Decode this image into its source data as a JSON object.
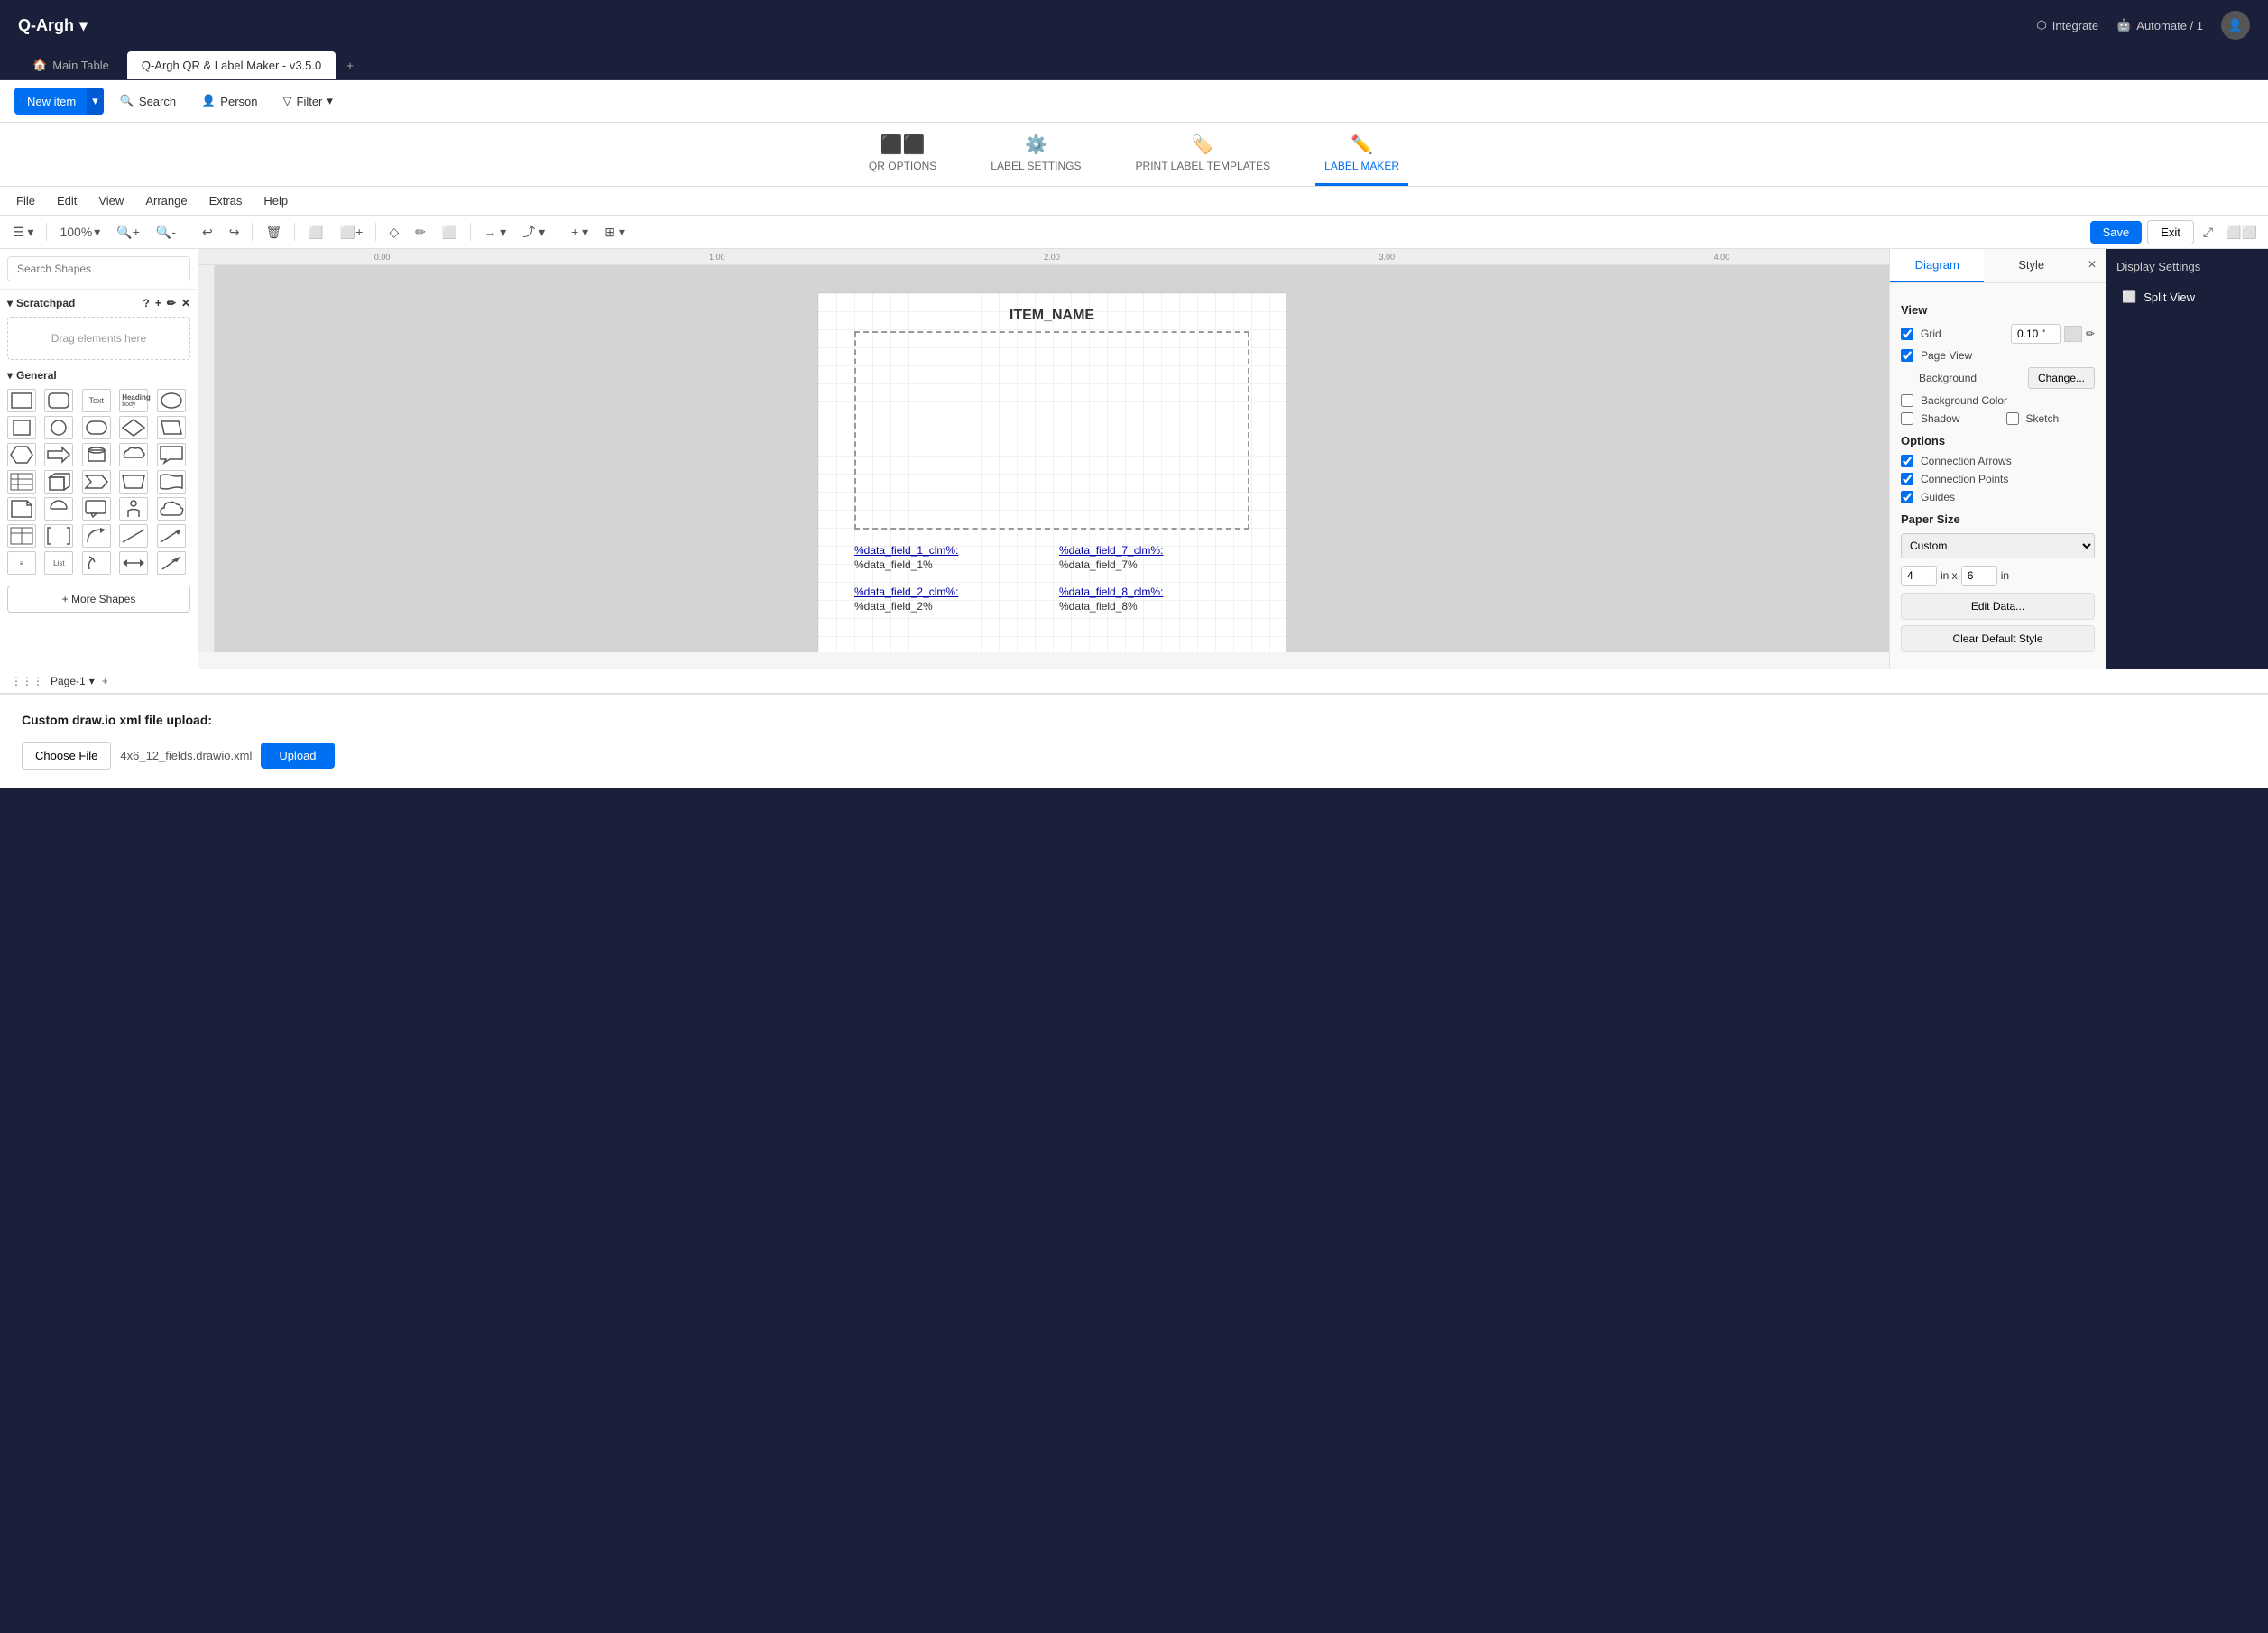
{
  "app": {
    "name": "Q-Argh",
    "dropdown_arrow": "▾"
  },
  "top_nav": {
    "integrate_label": "Integrate",
    "automate_label": "Automate / 1"
  },
  "tabs": [
    {
      "label": "Main Table",
      "icon": "🏠",
      "active": false
    },
    {
      "label": "Q-Argh QR & Label Maker - v3.5.0",
      "icon": "",
      "active": true
    },
    {
      "label": "+",
      "icon": "",
      "active": false
    }
  ],
  "toolbar": {
    "new_item_label": "New item",
    "search_label": "Search",
    "person_label": "Person",
    "filter_label": "Filter"
  },
  "sub_tabs": [
    {
      "label": "QR OPTIONS",
      "icon": "⬛",
      "active": false
    },
    {
      "label": "LABEL SETTINGS",
      "icon": "⚙️",
      "active": false
    },
    {
      "label": "PRINT LABEL TEMPLATES",
      "icon": "🏷️",
      "active": false
    },
    {
      "label": "LABEL MAKER",
      "icon": "✏️",
      "active": true
    }
  ],
  "menu_items": [
    "File",
    "Edit",
    "View",
    "Arrange",
    "Extras",
    "Help"
  ],
  "draw_toolbar": {
    "zoom_level": "100%",
    "save_label": "Save",
    "exit_label": "Exit"
  },
  "left_panel": {
    "search_placeholder": "Search Shapes",
    "scratchpad_label": "Scratchpad",
    "scratchpad_drag_text": "Drag elements here",
    "general_label": "General",
    "more_shapes_label": "+ More Shapes"
  },
  "canvas": {
    "item_name": "ITEM_NAME",
    "ruler_marks": [
      "0.00",
      "1.00",
      "2.00",
      "3.00",
      "4.00"
    ],
    "page_label": "Page-1",
    "fields": [
      {
        "label": "%data_field_1_clm%:",
        "value": "%data_field_1%"
      },
      {
        "label": "%data_field_7_clm%:",
        "value": "%data_field_7%"
      },
      {
        "label": "%data_field_2_clm%:",
        "value": "%data_field_2%"
      },
      {
        "label": "%data_field_8_clm%:",
        "value": "%data_field_8%"
      }
    ]
  },
  "right_panel": {
    "diagram_tab": "Diagram",
    "style_tab": "Style",
    "view_section": "View",
    "grid_label": "Grid",
    "grid_value": "0.10 \"",
    "page_view_label": "Page View",
    "background_label": "Background",
    "change_btn_label": "Change...",
    "background_color_label": "Background Color",
    "shadow_label": "Shadow",
    "sketch_label": "Sketch",
    "options_section": "Options",
    "connection_arrows_label": "Connection Arrows",
    "connection_points_label": "Connection Points",
    "guides_label": "Guides",
    "paper_size_section": "Paper Size",
    "paper_size_value": "Custom",
    "width_value": "4",
    "height_value": "6",
    "unit": "in",
    "edit_data_label": "Edit Data...",
    "clear_style_label": "Clear Default Style"
  },
  "display_settings": {
    "title": "Display Settings",
    "split_view_label": "Split View"
  },
  "bottom_section": {
    "title": "Custom draw.io xml file upload:",
    "choose_file_label": "Choose File",
    "file_name": "4x6_12_fields.drawio.xml",
    "upload_label": "Upload"
  }
}
